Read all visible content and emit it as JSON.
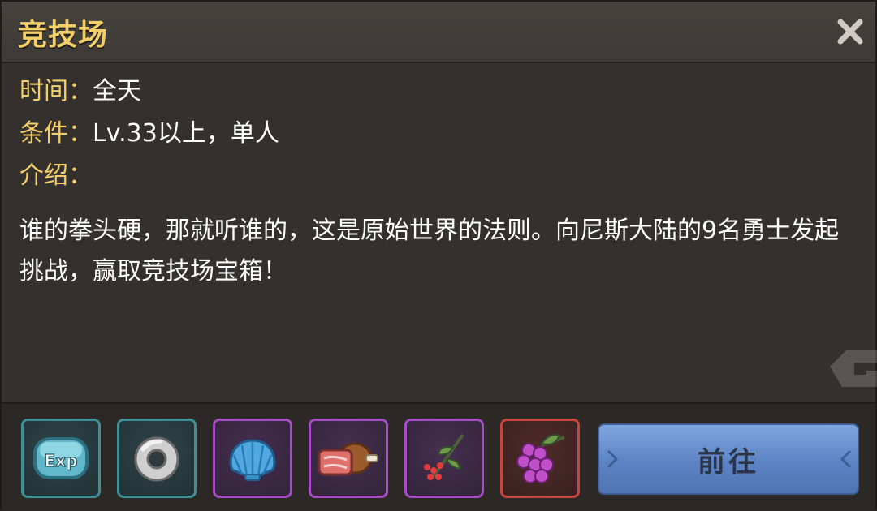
{
  "window": {
    "title": "竞技场",
    "close_icon": "close-icon"
  },
  "info": {
    "time_label": "时间：",
    "time_value": "全天",
    "condition_label": "条件：",
    "condition_value": "Lv.33以上，单人",
    "intro_label": "介绍：",
    "description": "谁的拳头硬，那就听谁的，这是原始世界的法则。向尼斯大陆的9名勇士发起挑战，赢取竞技场宝箱！"
  },
  "rewards": [
    {
      "icon": "exp-icon",
      "quality": "teal",
      "exp_text": "Exp"
    },
    {
      "icon": "stone-ring-icon",
      "quality": "teal"
    },
    {
      "icon": "shell-icon",
      "quality": "purple"
    },
    {
      "icon": "meat-icon",
      "quality": "purple"
    },
    {
      "icon": "berry-branch-icon",
      "quality": "purple"
    },
    {
      "icon": "grape-icon",
      "quality": "red"
    }
  ],
  "actions": {
    "go_label": "前往"
  },
  "colors": {
    "label_gold": "#f3cf6a",
    "quality_teal": "#3e8f96",
    "quality_purple": "#a54dc2",
    "quality_red": "#c8463e",
    "button_blue": "#5c83c4"
  }
}
